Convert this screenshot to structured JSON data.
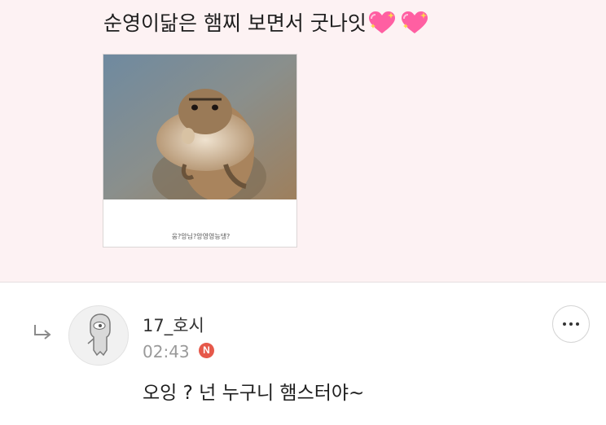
{
  "comment": {
    "text": "순영이닮은 햄찌 보면서 굿나잇",
    "emoji": [
      "sparkling-heart-icon",
      "sparkling-heart-icon"
    ],
    "image": {
      "caption": "웅?앙님?앙영영능댕?"
    }
  },
  "reply": {
    "author": "17_호시",
    "time": "02:43",
    "badge": "N",
    "text": "오잉 ? 넌 누구니 햄스터야~"
  },
  "colors": {
    "panel_bg": "#fdf2f3",
    "badge": "#e6584a",
    "heart": "#ff5fa2"
  }
}
